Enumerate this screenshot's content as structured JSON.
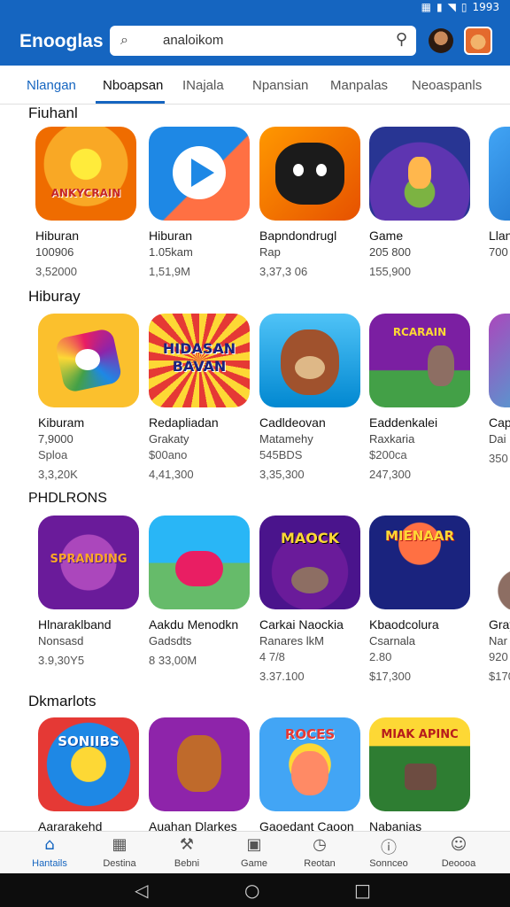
{
  "status": {
    "time": "1993",
    "battery_icon": "battery-icon",
    "wifi_icon": "wifi-icon"
  },
  "header": {
    "title": "Enooglas",
    "search": {
      "value": "analoikom",
      "leading_icon": "scan-icon",
      "trailing_icon": "search-icon"
    }
  },
  "tabs": [
    "Nlangan",
    "Nboapsan",
    "INajala",
    "Npansian",
    "Manpalas",
    "Neoaspanls"
  ],
  "sections": [
    {
      "title": "Fiuhanl",
      "apps": [
        {
          "name": "Hiburan",
          "sub": "100906",
          "price": "3,52000",
          "icon_text": "ANKYCRAIN",
          "colors": [
            "#f9a825",
            "#ef6c00"
          ]
        },
        {
          "name": "Hiburan",
          "sub": "1.05kam",
          "price": "1,51,9M",
          "icon_text": "",
          "colors": [
            "#1e88e5",
            "#ff7043"
          ]
        },
        {
          "name": "Bapndondrugl",
          "sub": "Rap",
          "price": "3,37,3 06",
          "icon_text": "",
          "colors": [
            "#e65100",
            "#ff9800"
          ]
        },
        {
          "name": "Game",
          "sub": "205 800",
          "price": "155,900",
          "icon_text": "",
          "colors": [
            "#283593",
            "#5e35b1"
          ]
        },
        {
          "name": "Llan",
          "sub": "700",
          "price": "",
          "icon_text": "",
          "colors": [
            "#42a5f5",
            "#1565c0"
          ]
        }
      ]
    },
    {
      "title": "Hiburay",
      "apps": [
        {
          "name": "Kiburam",
          "sub": "7,9000",
          "sub2": "Sploa",
          "price": "3,3,20K",
          "icon_text": "",
          "colors": [
            "#fbc02d",
            "#8e24aa"
          ]
        },
        {
          "name": "Redapliadan",
          "sub": "Grakaty",
          "sub2": "$00ano",
          "price": "4,41,300",
          "icon_text": "HIDASAN BAVAN",
          "colors": [
            "#e53935",
            "#fdd835"
          ]
        },
        {
          "name": "Cadldeovan",
          "sub": "Matamehy",
          "sub2": "545BDS",
          "price": "3,35,300",
          "icon_text": "",
          "colors": [
            "#29b6f6",
            "#0288d1"
          ]
        },
        {
          "name": "Eaddenkalei",
          "sub": "Raxkaria",
          "sub2": "$200ca",
          "price": "247,300",
          "icon_text": "RCARAIN",
          "colors": [
            "#7b1fa2",
            "#43a047"
          ]
        },
        {
          "name": "Cap",
          "sub": "Dai",
          "sub2": "",
          "price": "350",
          "icon_text": "",
          "colors": [
            "#ab47bc",
            "#26c6da"
          ]
        }
      ]
    },
    {
      "title": "PHDLRONS",
      "apps": [
        {
          "name": "Hlnaraklband",
          "sub": "Nonsasd",
          "sub2": "",
          "price": "3.9,30Y5",
          "icon_text": "SPRANDING",
          "colors": [
            "#6a1b9a",
            "#8e24aa"
          ]
        },
        {
          "name": "Aakdu Menodkn",
          "sub": "Gadsdts",
          "sub2": "",
          "price": "8 33,00M",
          "icon_text": "",
          "colors": [
            "#66bb6a",
            "#29b6f6"
          ]
        },
        {
          "name": "Carkai Naockia",
          "sub": "Ranares lkM",
          "sub2": "4 7/8",
          "price": "3.37.100",
          "icon_text": "MAOCK",
          "colors": [
            "#4a148c",
            "#f9a825"
          ]
        },
        {
          "name": "Kbaodcolura",
          "sub": "Csarnala",
          "sub2": "2.80",
          "price": "$17,300",
          "icon_text": "MIENAAR",
          "colors": [
            "#1a237e",
            "#ff7043"
          ]
        },
        {
          "name": "Gray",
          "sub": "Nar",
          "sub2": "920",
          "price": "$170",
          "icon_text": "",
          "colors": [
            "#ffffff",
            "#8d6e63"
          ]
        }
      ]
    },
    {
      "title": "Dkmarlots",
      "apps": [
        {
          "name": "Aararakehd",
          "icon_text": "SONIIBS",
          "colors": [
            "#1e88e5",
            "#e53935"
          ]
        },
        {
          "name": "Auahan Dlarkes",
          "icon_text": "",
          "colors": [
            "#8e24aa",
            "#ffa726"
          ]
        },
        {
          "name": "Gaoedant Caoon",
          "icon_text": "ROCES",
          "colors": [
            "#42a5f5",
            "#fdd835"
          ]
        },
        {
          "name": "Nabanias",
          "icon_text": "MIAK APINC",
          "colors": [
            "#2e7d32",
            "#fdd835"
          ]
        }
      ]
    }
  ],
  "bottom_nav": [
    {
      "label": "Hantails",
      "icon": "home-icon",
      "active": true
    },
    {
      "label": "Destina",
      "icon": "apps-icon",
      "active": false
    },
    {
      "label": "Bebni",
      "icon": "tools-icon",
      "active": false
    },
    {
      "label": "Game",
      "icon": "games-icon",
      "active": false
    },
    {
      "label": "Reotan",
      "icon": "timer-icon",
      "active": false
    },
    {
      "label": "Sonnceo",
      "icon": "info-icon",
      "active": false
    },
    {
      "label": "Deoooa",
      "icon": "account-icon",
      "active": false
    }
  ],
  "system_nav": [
    "back-icon",
    "home-circle-icon",
    "recents-icon"
  ]
}
